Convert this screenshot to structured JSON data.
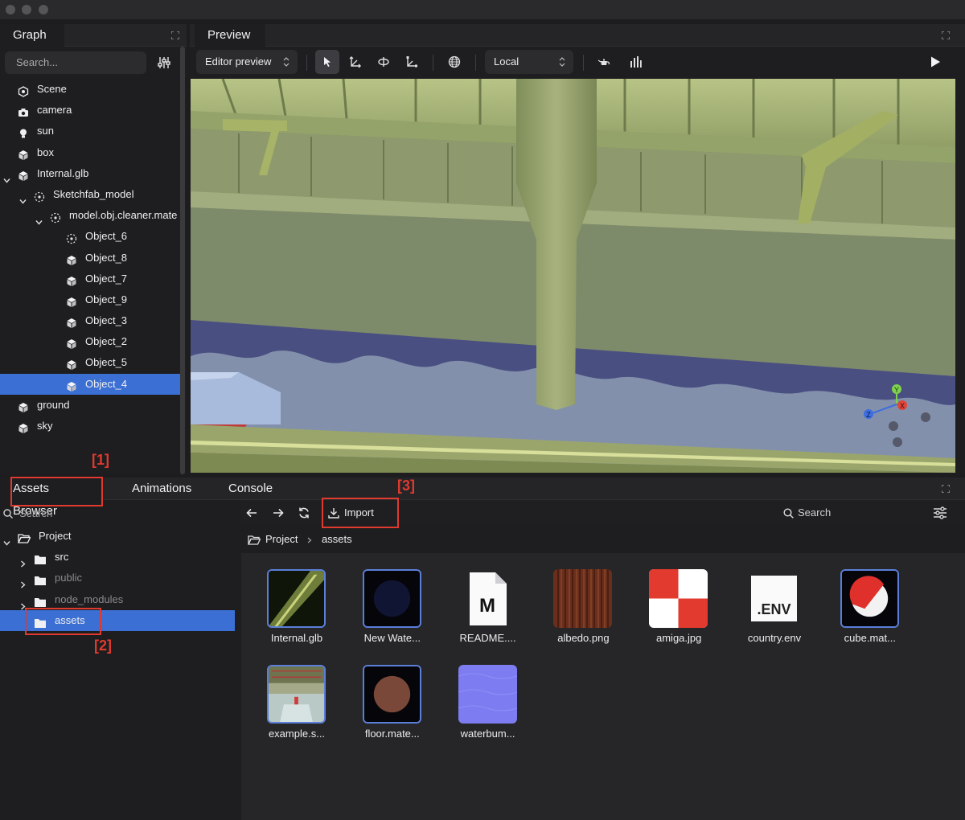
{
  "graph": {
    "tab_label": "Graph",
    "search_placeholder": "Search...",
    "items": [
      {
        "label": "Scene",
        "icon": "scene-icon",
        "level": 0,
        "expanded": null,
        "selected": false
      },
      {
        "label": "camera",
        "icon": "camera-icon",
        "level": 0,
        "expanded": null,
        "selected": false
      },
      {
        "label": "sun",
        "icon": "light-bulb-icon",
        "level": 0,
        "expanded": null,
        "selected": false
      },
      {
        "label": "box",
        "icon": "cube-icon",
        "level": 0,
        "expanded": null,
        "selected": false
      },
      {
        "label": "Internal.glb",
        "icon": "cube-icon",
        "level": 0,
        "expanded": true,
        "selected": false
      },
      {
        "label": "Sketchfab_model",
        "icon": "dashed-node-icon",
        "level": 1,
        "expanded": true,
        "selected": false
      },
      {
        "label": "model.obj.cleaner.mate",
        "icon": "dashed-node-icon",
        "level": 2,
        "expanded": true,
        "selected": false
      },
      {
        "label": "Object_6",
        "icon": "dashed-node-icon",
        "level": 3,
        "expanded": null,
        "selected": false
      },
      {
        "label": "Object_8",
        "icon": "cube-icon",
        "level": 3,
        "expanded": null,
        "selected": false
      },
      {
        "label": "Object_7",
        "icon": "cube-icon",
        "level": 3,
        "expanded": null,
        "selected": false
      },
      {
        "label": "Object_9",
        "icon": "cube-icon",
        "level": 3,
        "expanded": null,
        "selected": false
      },
      {
        "label": "Object_3",
        "icon": "cube-icon",
        "level": 3,
        "expanded": null,
        "selected": false
      },
      {
        "label": "Object_2",
        "icon": "cube-icon",
        "level": 3,
        "expanded": null,
        "selected": false
      },
      {
        "label": "Object_5",
        "icon": "cube-icon",
        "level": 3,
        "expanded": null,
        "selected": false
      },
      {
        "label": "Object_4",
        "icon": "cube-icon",
        "level": 3,
        "expanded": null,
        "selected": true
      },
      {
        "label": "ground",
        "icon": "cube-icon",
        "level": 0,
        "expanded": null,
        "selected": false
      },
      {
        "label": "sky",
        "icon": "cube-icon",
        "level": 0,
        "expanded": null,
        "selected": false
      }
    ]
  },
  "preview": {
    "tab_label": "Preview",
    "mode_select": "Editor preview",
    "space_select": "Local",
    "gizmo_axes": [
      "Y",
      "X",
      "Z"
    ]
  },
  "bottom": {
    "tabs": [
      "Assets Browser",
      "Animations",
      "Console"
    ],
    "left_search_placeholder": "Search",
    "project_tree": [
      {
        "label": "Project",
        "level": 0,
        "expanded": true,
        "open_folder": true,
        "dim": false,
        "selected": false
      },
      {
        "label": "src",
        "level": 1,
        "expanded": false,
        "open_folder": false,
        "dim": false,
        "selected": false
      },
      {
        "label": "public",
        "level": 1,
        "expanded": false,
        "open_folder": false,
        "dim": true,
        "selected": false
      },
      {
        "label": "node_modules",
        "level": 1,
        "expanded": false,
        "open_folder": false,
        "dim": true,
        "selected": false
      },
      {
        "label": "assets",
        "level": 1,
        "expanded": null,
        "open_folder": false,
        "dim": false,
        "selected": true
      }
    ],
    "import_label": "Import",
    "search_label": "Search",
    "breadcrumb": [
      "Project",
      "assets"
    ],
    "assets": [
      {
        "name": "Internal.glb",
        "thumb": "glb-model-thumbnail"
      },
      {
        "name": "New Wate...",
        "thumb": "water-material-thumbnail"
      },
      {
        "name": "README....",
        "thumb": "markdown-file-icon"
      },
      {
        "name": "albedo.png",
        "thumb": "wood-texture-thumbnail"
      },
      {
        "name": "amiga.jpg",
        "thumb": "checker-texture-thumbnail"
      },
      {
        "name": "country.env",
        "thumb": "env-file-icon"
      },
      {
        "name": "cube.mat...",
        "thumb": "material-sphere-thumbnail"
      },
      {
        "name": "example.s...",
        "thumb": "scene-thumbnail"
      },
      {
        "name": "floor.mate...",
        "thumb": "floor-material-thumbnail"
      },
      {
        "name": "waterbum...",
        "thumb": "normal-map-thumbnail"
      }
    ]
  },
  "file_icons": {
    "markdown_letter": "M",
    "env_text": ".ENV"
  },
  "annotations": [
    "[1]",
    "[2]",
    "[3]"
  ],
  "colors": {
    "accent": "#3b6fd3",
    "annotation": "#e03a2f",
    "panel": "#1e1e20"
  }
}
